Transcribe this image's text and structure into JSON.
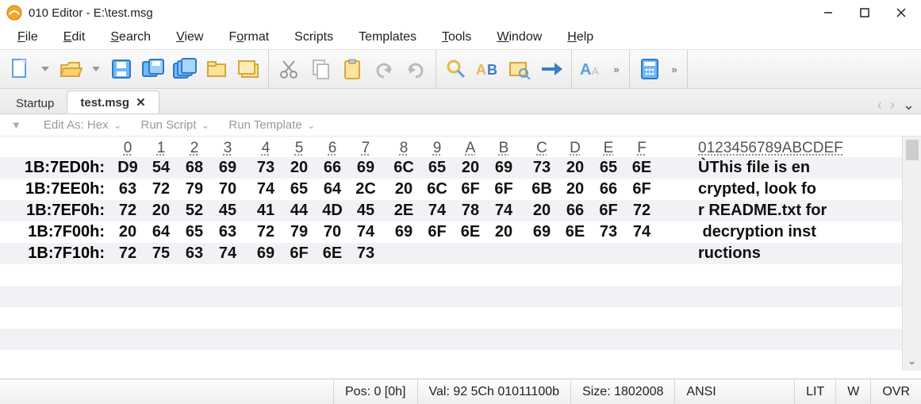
{
  "window": {
    "title": "010 Editor - E:\\test.msg"
  },
  "menu": {
    "file": "File",
    "edit": "Edit",
    "search": "Search",
    "view": "View",
    "format": "Format",
    "scripts": "Scripts",
    "templates": "Templates",
    "tools": "Tools",
    "window": "Window",
    "help": "Help"
  },
  "tabs": {
    "startup": "Startup",
    "active": "test.msg"
  },
  "subbar": {
    "edit_as": "Edit As: Hex",
    "run_script": "Run Script",
    "run_template": "Run Template"
  },
  "hex": {
    "col_labels": [
      "0",
      "1",
      "2",
      "3",
      "4",
      "5",
      "6",
      "7",
      "8",
      "9",
      "A",
      "B",
      "C",
      "D",
      "E",
      "F"
    ],
    "ascii_header": "0123456789ABCDEF",
    "rows": [
      {
        "addr": "1B:7ED0h:",
        "bytes": [
          "D9",
          "54",
          "68",
          "69",
          "73",
          "20",
          "66",
          "69",
          "6C",
          "65",
          "20",
          "69",
          "73",
          "20",
          "65",
          "6E"
        ],
        "ascii": "ÙThis file is en"
      },
      {
        "addr": "1B:7EE0h:",
        "bytes": [
          "63",
          "72",
          "79",
          "70",
          "74",
          "65",
          "64",
          "2C",
          "20",
          "6C",
          "6F",
          "6F",
          "6B",
          "20",
          "66",
          "6F"
        ],
        "ascii": "crypted, look fo"
      },
      {
        "addr": "1B:7EF0h:",
        "bytes": [
          "72",
          "20",
          "52",
          "45",
          "41",
          "44",
          "4D",
          "45",
          "2E",
          "74",
          "78",
          "74",
          "20",
          "66",
          "6F",
          "72"
        ],
        "ascii": "r README.txt for"
      },
      {
        "addr": "1B:7F00h:",
        "bytes": [
          "20",
          "64",
          "65",
          "63",
          "72",
          "79",
          "70",
          "74",
          "69",
          "6F",
          "6E",
          "20",
          "69",
          "6E",
          "73",
          "74"
        ],
        "ascii": " decryption inst"
      },
      {
        "addr": "1B:7F10h:",
        "bytes": [
          "72",
          "75",
          "63",
          "74",
          "69",
          "6F",
          "6E",
          "73",
          "",
          "",
          "",
          "",
          "",
          "",
          "",
          ""
        ],
        "ascii": "ructions"
      }
    ]
  },
  "status": {
    "pos": "Pos: 0 [0h]",
    "val": "Val: 92 5Ch 01011100b",
    "size": "Size: 1802008",
    "enc": "ANSI",
    "end": "LIT",
    "w": "W",
    "ovr": "OVR"
  }
}
